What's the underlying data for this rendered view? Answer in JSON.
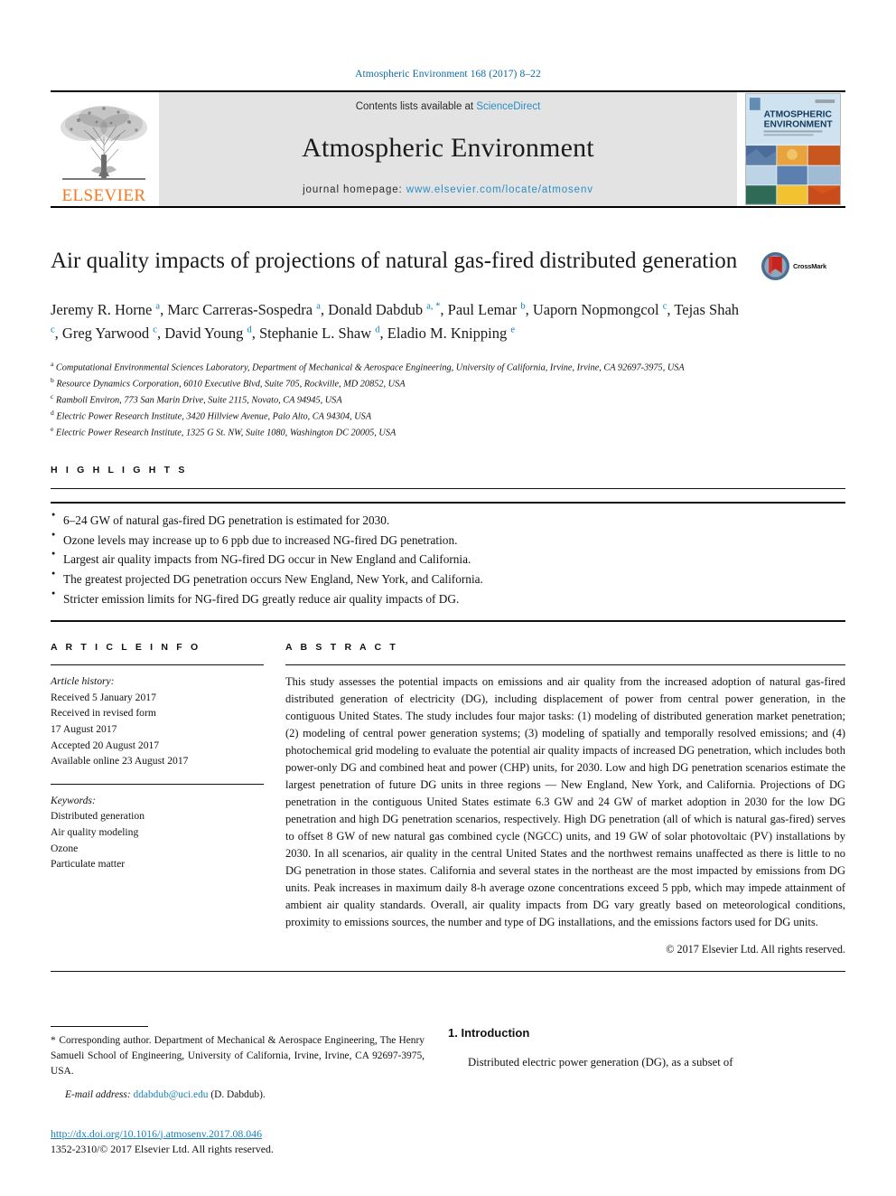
{
  "running_head": "Atmospheric Environment 168 (2017) 8–22",
  "banner": {
    "publisher_name": "ELSEVIER",
    "contents_prefix": "Contents lists available at ",
    "contents_link": "ScienceDirect",
    "journal_title": "Atmospheric Environment",
    "homepage_prefix": "journal homepage: ",
    "homepage_url": "www.elsevier.com/locate/atmosenv",
    "cover_title_line1": "ATMOSPHERIC",
    "cover_title_line2": "ENVIRONMENT",
    "accent_link_color": "#2a8ec4",
    "publisher_color": "#f47920",
    "band_color": "#e3e3e3"
  },
  "article": {
    "title": "Air quality impacts of projections of natural gas-fired distributed generation",
    "crossmark_label": "CrossMark",
    "authors": [
      {
        "name": "Jeremy R. Horne",
        "sup": "a",
        "sep": ", "
      },
      {
        "name": "Marc Carreras-Sospedra",
        "sup": "a",
        "sep": ", "
      },
      {
        "name": "Donald Dabdub",
        "sup": "a, *",
        "sep": ", "
      },
      {
        "name": "Paul Lemar",
        "sup": "b",
        "sep": ", "
      },
      {
        "name": "Uaporn Nopmongcol",
        "sup": "c",
        "sep": ", "
      },
      {
        "name": "Tejas Shah",
        "sup": "c",
        "sep": ", "
      },
      {
        "name": "Greg Yarwood",
        "sup": "c",
        "sep": ", "
      },
      {
        "name": "David Young",
        "sup": "d",
        "sep": ", "
      },
      {
        "name": "Stephanie L. Shaw",
        "sup": "d",
        "sep": ", "
      },
      {
        "name": "Eladio M. Knipping",
        "sup": "e",
        "sep": ""
      }
    ],
    "affiliations": [
      {
        "mark": "a",
        "text": "Computational Environmental Sciences Laboratory, Department of Mechanical & Aerospace Engineering, University of California, Irvine, Irvine, CA 92697-3975, USA"
      },
      {
        "mark": "b",
        "text": "Resource Dynamics Corporation, 6010 Executive Blvd, Suite 705, Rockville, MD 20852, USA"
      },
      {
        "mark": "c",
        "text": "Ramboll Environ, 773 San Marin Drive, Suite 2115, Novato, CA 94945, USA"
      },
      {
        "mark": "d",
        "text": "Electric Power Research Institute, 3420 Hillview Avenue, Palo Alto, CA 94304, USA"
      },
      {
        "mark": "e",
        "text": "Electric Power Research Institute, 1325 G St. NW, Suite 1080, Washington DC 20005, USA"
      }
    ]
  },
  "highlights": {
    "heading": "H I G H L I G H T S",
    "items": [
      "6–24 GW of natural gas-fired DG penetration is estimated for 2030.",
      "Ozone levels may increase up to 6 ppb due to increased NG-fired DG penetration.",
      "Largest air quality impacts from NG-fired DG occur in New England and California.",
      "The greatest projected DG penetration occurs New England, New York, and California.",
      "Stricter emission limits for NG-fired DG greatly reduce air quality impacts of DG."
    ]
  },
  "article_info": {
    "heading": "A R T I C L E   I N F O",
    "history_label": "Article history:",
    "history": [
      "Received 5 January 2017",
      "Received in revised form",
      "17 August 2017",
      "Accepted 20 August 2017",
      "Available online 23 August 2017"
    ],
    "keywords_label": "Keywords:",
    "keywords": [
      "Distributed generation",
      "Air quality modeling",
      "Ozone",
      "Particulate matter"
    ]
  },
  "abstract": {
    "heading": "A B S T R A C T",
    "text": "This study assesses the potential impacts on emissions and air quality from the increased adoption of natural gas-fired distributed generation of electricity (DG), including displacement of power from central power generation, in the contiguous United States. The study includes four major tasks: (1) modeling of distributed generation market penetration; (2) modeling of central power generation systems; (3) modeling of spatially and temporally resolved emissions; and (4) photochemical grid modeling to evaluate the potential air quality impacts of increased DG penetration, which includes both power-only DG and combined heat and power (CHP) units, for 2030. Low and high DG penetration scenarios estimate the largest penetration of future DG units in three regions — New England, New York, and California. Projections of DG penetration in the contiguous United States estimate 6.3 GW and 24 GW of market adoption in 2030 for the low DG penetration and high DG penetration scenarios, respectively. High DG penetration (all of which is natural gas-fired) serves to offset 8 GW of new natural gas combined cycle (NGCC) units, and 19 GW of solar photovoltaic (PV) installations by 2030. In all scenarios, air quality in the central United States and the northwest remains unaffected as there is little to no DG penetration in those states. California and several states in the northeast are the most impacted by emissions from DG units. Peak increases in maximum daily 8-h average ozone concentrations exceed 5 ppb, which may impede attainment of ambient air quality standards. Overall, air quality impacts from DG vary greatly based on meteorological conditions, proximity to emissions sources, the number and type of DG installations, and the emissions factors used for DG units.",
    "copyright": "© 2017 Elsevier Ltd. All rights reserved."
  },
  "footer": {
    "corresponding_star": "*",
    "corresponding_text": "Corresponding author. Department of Mechanical & Aerospace Engineering, The Henry Samueli School of Engineering, University of California, Irvine, Irvine, CA 92697-3975, USA.",
    "email_label": "E-mail address:",
    "email": "ddabdub@uci.edu",
    "email_suffix": "(D. Dabdub).",
    "doi": "http://dx.doi.org/10.1016/j.atmosenv.2017.08.046",
    "issn_line": "1352-2310/© 2017 Elsevier Ltd. All rights reserved."
  },
  "introduction": {
    "heading": "1. Introduction",
    "first_paragraph": "Distributed electric power generation (DG), as a subset of"
  }
}
